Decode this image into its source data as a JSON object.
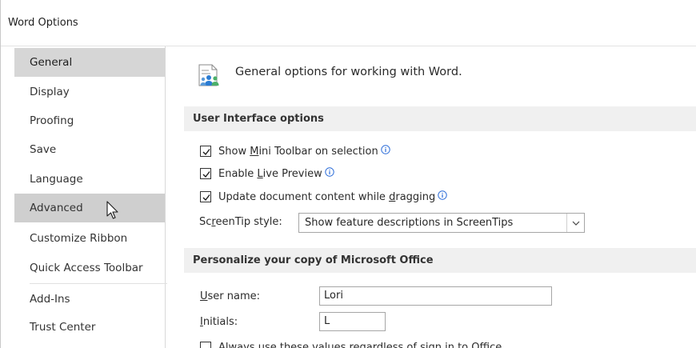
{
  "window": {
    "title": "Word Options"
  },
  "sidebar": {
    "items": [
      {
        "id": "general",
        "label": "General"
      },
      {
        "id": "display",
        "label": "Display"
      },
      {
        "id": "proofing",
        "label": "Proofing"
      },
      {
        "id": "save",
        "label": "Save"
      },
      {
        "id": "language",
        "label": "Language"
      },
      {
        "id": "advanced",
        "label": "Advanced"
      },
      {
        "id": "customize-ribbon",
        "label": "Customize Ribbon"
      },
      {
        "id": "quick-access-toolbar",
        "label": "Quick Access Toolbar"
      },
      {
        "id": "add-ins",
        "label": "Add-Ins"
      },
      {
        "id": "trust-center",
        "label": "Trust Center"
      }
    ],
    "selected": "General",
    "hovered": "Advanced"
  },
  "main": {
    "hero_text": "General options for working with Word.",
    "ui_options": {
      "header": "User Interface options",
      "mini_toolbar": {
        "prefix": "Show ",
        "accel": "M",
        "suffix": "ini Toolbar on selection",
        "checked": true
      },
      "live_preview": {
        "prefix": "Enable ",
        "accel": "L",
        "suffix": "ive Preview",
        "checked": true
      },
      "update_dragging": {
        "prefix": "Update document content while ",
        "accel": "d",
        "suffix": "ragging",
        "checked": true
      },
      "screentip": {
        "label_prefix": "Sc",
        "label_accel": "r",
        "label_suffix": "eenTip style:",
        "value": "Show feature descriptions in ScreenTips"
      }
    },
    "personalize": {
      "header": "Personalize your copy of Microsoft Office",
      "user_name": {
        "label_accel": "U",
        "label_suffix": "ser name:",
        "value": "Lori"
      },
      "initials": {
        "label_accel": "I",
        "label_suffix": "nitials:",
        "value": "L"
      },
      "always_use": {
        "prefix": "Always use these values regardless of sign in to Office.",
        "checked": false
      }
    }
  },
  "colors": {
    "selected_bg": "#d6d6d6",
    "section_bg": "#f0f0f0",
    "info_blue": "#2b6cd8",
    "hero_blue": "#2b7cd3",
    "hero_green": "#4caf6a"
  }
}
